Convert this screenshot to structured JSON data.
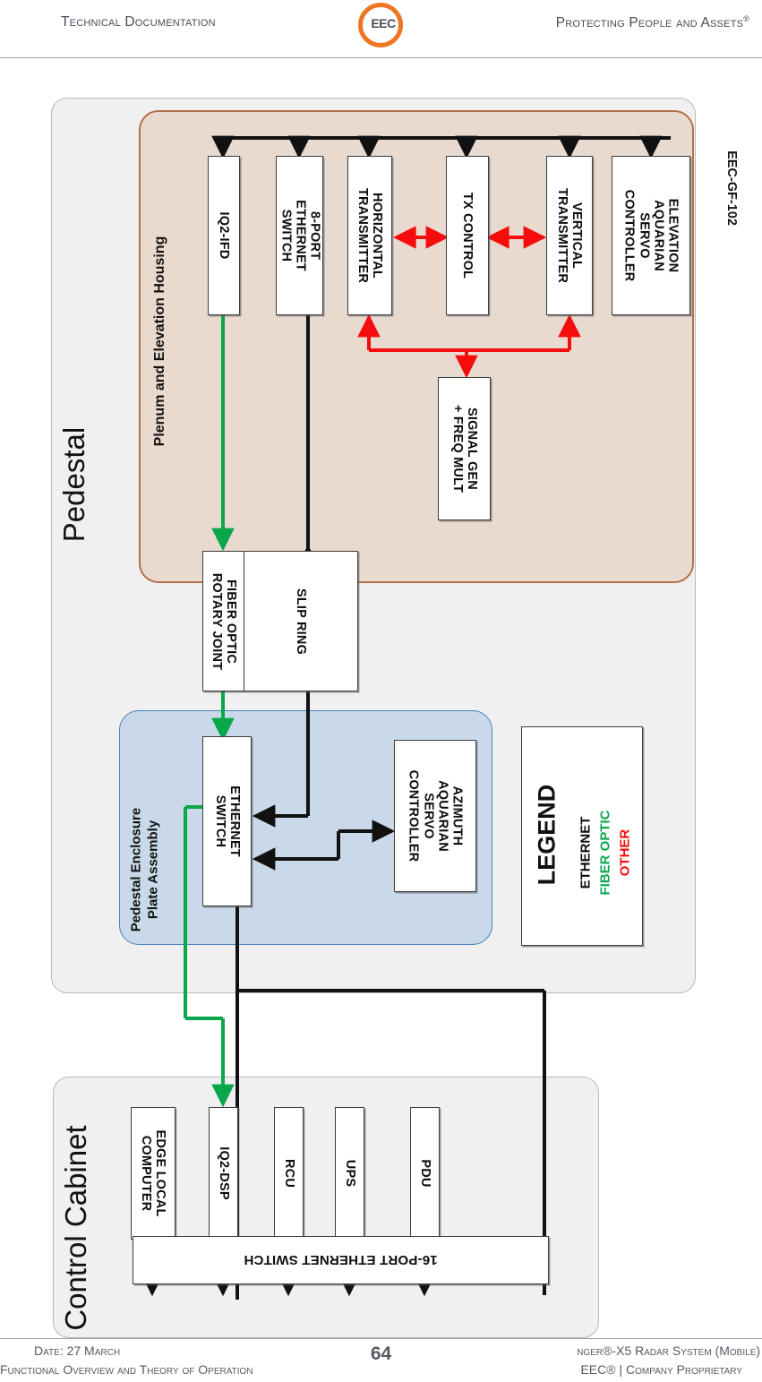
{
  "header": {
    "left": "Technical Documentation",
    "right": "Protecting People and Assets",
    "right_sup": "®",
    "logo_text": "EEC"
  },
  "side_code": "EEC-GF-102",
  "footer": {
    "left_line1": "Date: 27 March",
    "left_line2": "Functional Overview and Theory of Operation",
    "right_line1": "nger®-X5 Radar System (Mobile)",
    "right_line2": "EEC® | Company Proprietary",
    "page_number": "64"
  },
  "diagram": {
    "groups": {
      "pedestal": "Pedestal",
      "control_cabinet": "Control Cabinet",
      "plenum": "Plenum and Elevation Housing",
      "pedestal_enclosure": "Pedestal Enclosure\nPlate Assembly"
    },
    "plenum_blocks": [
      {
        "id": "iq2-ifd",
        "label": "IQ2-IFD"
      },
      {
        "id": "8-port-ethernet-switch",
        "label": "8-PORT\nETHERNET\nSWITCH"
      },
      {
        "id": "horizontal-transmitter",
        "label": "HORIZONTAL\nTRANSMITTER"
      },
      {
        "id": "tx-control",
        "label": "TX CONTROL"
      },
      {
        "id": "vertical-transmitter",
        "label": "VERTICAL\nTRANSMITTER"
      },
      {
        "id": "elevation-aquarian-servo-controller",
        "label": "ELEVATION\nAQUARIAN\nSERVO\nCONTROLLER"
      },
      {
        "id": "signal-gen-freq-mult",
        "label": "SIGNAL GEN\n+ FREQ MULT"
      }
    ],
    "rotary_blocks": [
      {
        "id": "fiber-optic-rotary-joint",
        "label": "FIBER OPTIC\nROTARY JOINT"
      },
      {
        "id": "slip-ring",
        "label": "SLIP RING"
      }
    ],
    "enclosure_blocks": [
      {
        "id": "ethernet-switch",
        "label": "ETHERNET\nSWITCH"
      },
      {
        "id": "azimuth-aquarian-servo-controller",
        "label": "AZIMUTH\nAQUARIAN\nSERVO\nCONTROLLER"
      }
    ],
    "cabinet_blocks": [
      {
        "id": "edge-local-computer",
        "label": "EDGE LOCAL\nCOMPUTER"
      },
      {
        "id": "iq2-dsp",
        "label": "IQ2-DSP"
      },
      {
        "id": "rcu",
        "label": "RCU"
      },
      {
        "id": "ups",
        "label": "UPS"
      },
      {
        "id": "pdu",
        "label": "PDU"
      }
    ],
    "switch_16": "16-PORT ETHERNET SWITCH",
    "legend": {
      "title": "LEGEND",
      "items": [
        {
          "label": "ETHERNET",
          "color": "#0d0d0d"
        },
        {
          "label": "FIBER OPTIC",
          "color": "#0aa64b"
        },
        {
          "label": "OTHER",
          "color": "#f50d0d"
        }
      ]
    },
    "colors": {
      "ethernet": "#111111",
      "fiber_optic": "#0aa64b",
      "other": "#f50d0d",
      "plenum_fill": "#e9dad0",
      "plenum_stroke": "#b3714b",
      "enclosure_fill": "#c9d9e9",
      "enclosure_stroke": "#4a80bf",
      "panel_fill": "#f0f0f0",
      "panel_stroke": "#b9b9b9",
      "brand_orange": "#ee7623"
    }
  }
}
